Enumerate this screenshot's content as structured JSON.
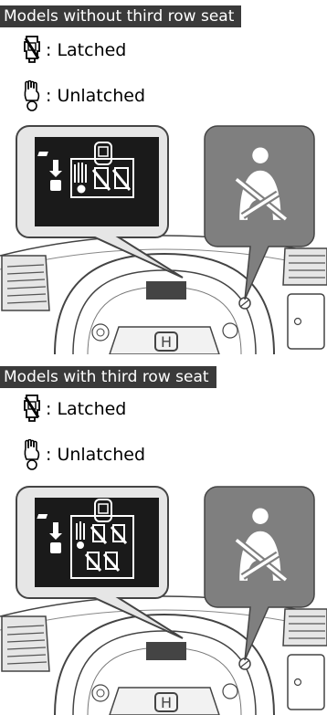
{
  "sections": [
    {
      "header": "Models without third row seat",
      "legend": [
        {
          "icon": "seatbelt-latched-icon",
          "text": ": Latched"
        },
        {
          "icon": "seatbelt-unlatched-icon",
          "text": ": Unlatched"
        }
      ]
    },
    {
      "header": "Models with third row seat",
      "legend": [
        {
          "icon": "seatbelt-latched-icon",
          "text": ": Latched"
        },
        {
          "icon": "seatbelt-unlatched-icon",
          "text": ": Unlatched"
        }
      ]
    }
  ],
  "colors": {
    "header_bg": "#3a3a3a",
    "callout_gray": "#7f7f7f",
    "display_bg": "#1a1a1a",
    "line_art": "#444444"
  }
}
